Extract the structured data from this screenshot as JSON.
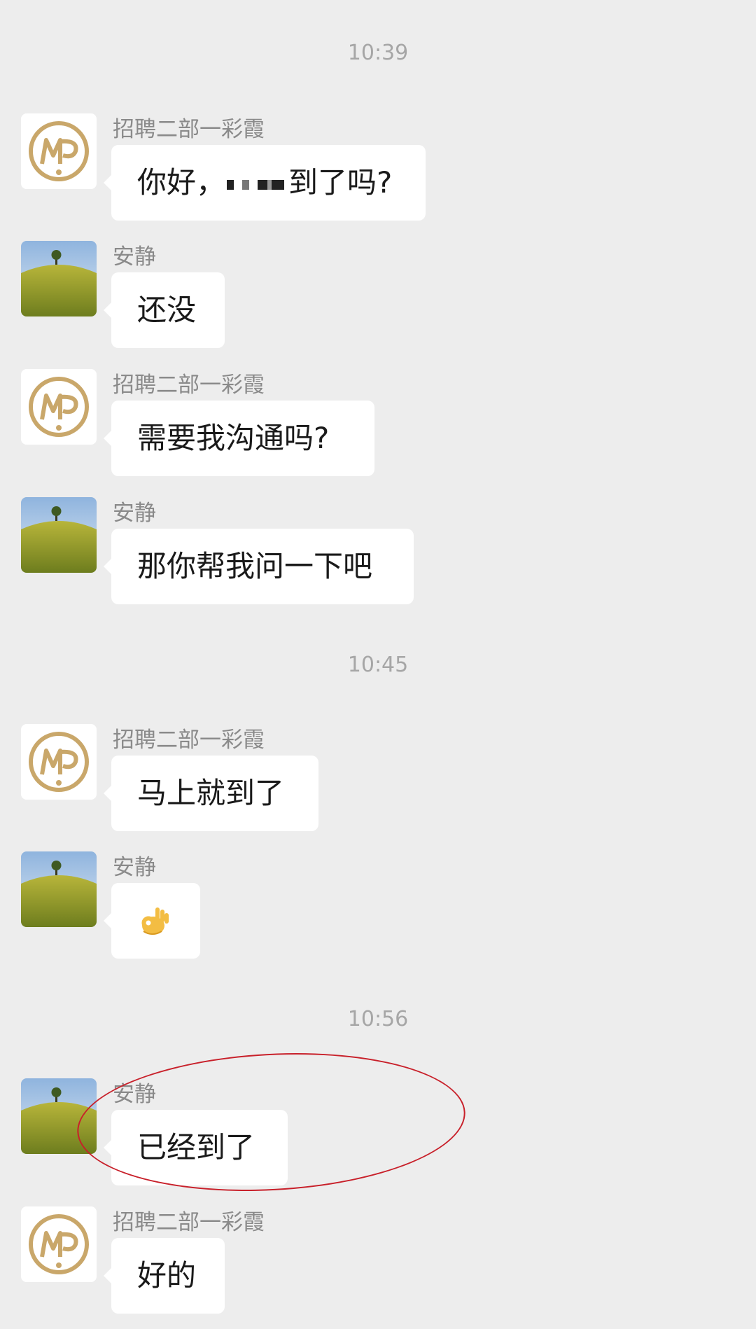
{
  "contacts": {
    "recruiter": {
      "name": "招聘二部一彩霞",
      "avatar_icon": "mp-logo-icon"
    },
    "user": {
      "name": "安静",
      "avatar_icon": "landscape-tree-avatar-icon"
    }
  },
  "timestamps": [
    "10:39",
    "10:45",
    "10:56"
  ],
  "messages": [
    {
      "sender": "招聘二部一彩霞",
      "text_before": "你好，",
      "text_after": "到了吗?",
      "redacted": true
    },
    {
      "sender": "安静",
      "text": "还没"
    },
    {
      "sender": "招聘二部一彩霞",
      "text": "需要我沟通吗?"
    },
    {
      "sender": "安静",
      "text": "那你帮我问一下吧"
    },
    {
      "sender": "招聘二部一彩霞",
      "text": "马上就到了"
    },
    {
      "sender": "安静",
      "emoji": "ok-hand-emoji"
    },
    {
      "sender": "安静",
      "text": "已经到了",
      "annotated": true
    },
    {
      "sender": "招聘二部一彩霞",
      "text": "好的"
    }
  ],
  "colors": {
    "background": "#ededed",
    "bubble": "#ffffff",
    "annotation": "#c8202a",
    "logo_gold": "#c9a76a"
  }
}
